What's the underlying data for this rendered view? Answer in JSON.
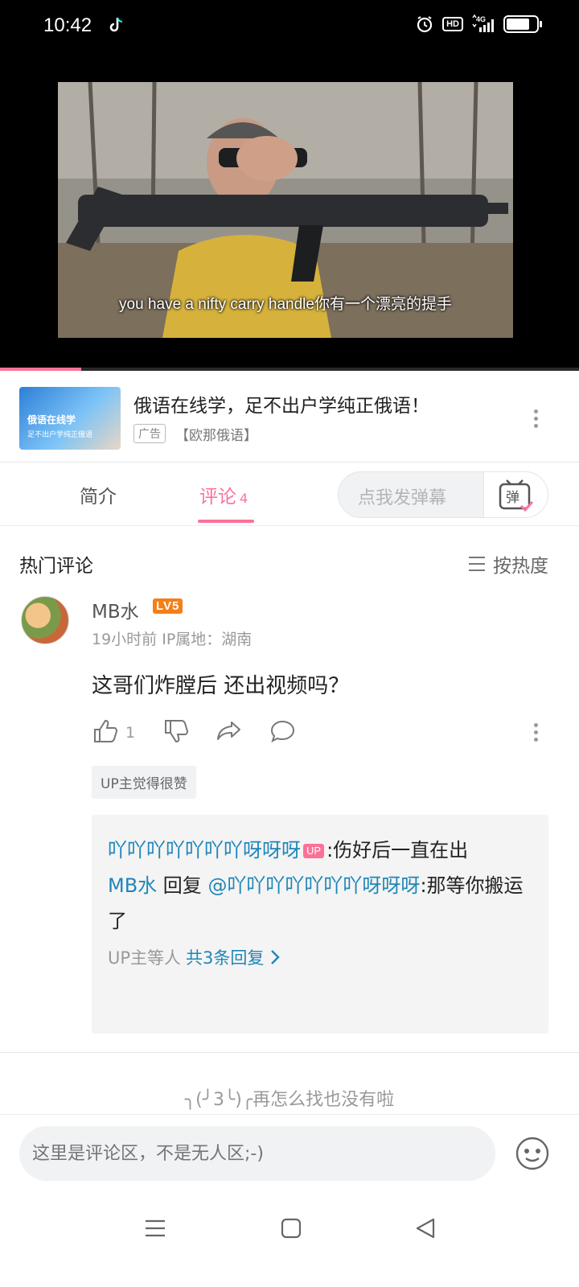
{
  "status_bar": {
    "time": "10:42",
    "hd_label": "HD",
    "signal_label": "4G",
    "battery_level": 0.8
  },
  "video": {
    "subtitle": "you have a nifty carry handle你有一个漂亮的提手",
    "progress": 0.14
  },
  "ad": {
    "thumb_title": "俄语在线学",
    "thumb_subtitle": "足不出户学纯正俄语",
    "title": "俄语在线学，足不出户学纯正俄语！",
    "tag": "广告",
    "source": "【欧那俄语】"
  },
  "tabs": {
    "intro_label": "简介",
    "comments_label": "评论",
    "comments_count": "4",
    "danmaku_placeholder": "点我发弹幕",
    "danmaku_icon_text": "弹"
  },
  "comments_section": {
    "header": "热门评论",
    "sort_label": "按热度"
  },
  "comment": {
    "username": "MB水",
    "level": "LV5",
    "meta": "19小时前  IP属地：湖南",
    "text": "这哥们炸膛后 还出视频吗？",
    "like_count": "1",
    "up_liked_label": "UP主觉得很赞",
    "replies": [
      {
        "author": "吖吖吖吖吖吖吖呀呀呀",
        "badge": "UP",
        "text": ":伤好后一直在出"
      },
      {
        "author": "MB水",
        "reply_word": " 回复 ",
        "mention": "@吖吖吖吖吖吖吖呀呀呀",
        "text": ":那等你搬运了"
      }
    ],
    "reply_footer_prefix": "UP主等人",
    "reply_footer_link": "共3条回复"
  },
  "end_text": "╮(╯3╰)╭再怎么找也没有啦",
  "input": {
    "placeholder": "这里是评论区，不是无人区;-)"
  }
}
